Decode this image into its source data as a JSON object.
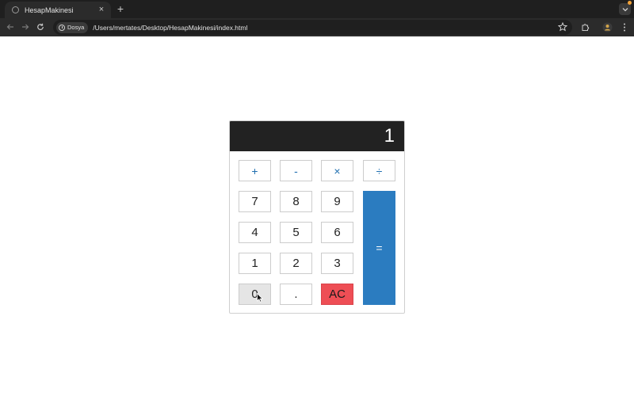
{
  "browser": {
    "tab_title": "HesapMakinesi",
    "chip_label": "Dosya",
    "url": "/Users/mertates/Desktop/HesapMakinesi/index.html",
    "new_tab": "+",
    "close": "×"
  },
  "calculator": {
    "display": "1",
    "operators": {
      "add": "+",
      "subtract": "-",
      "multiply": "×",
      "divide": "÷"
    },
    "digits": {
      "d7": "7",
      "d8": "8",
      "d9": "9",
      "d4": "4",
      "d5": "5",
      "d6": "6",
      "d1": "1",
      "d2": "2",
      "d3": "3",
      "d0": "0"
    },
    "decimal": ".",
    "clear": "AC",
    "equals": "="
  },
  "colors": {
    "display_bg": "#222222",
    "operator_text": "#1f6fb0",
    "equals_bg": "#2b7cc0",
    "clear_bg": "#ee4e55"
  }
}
